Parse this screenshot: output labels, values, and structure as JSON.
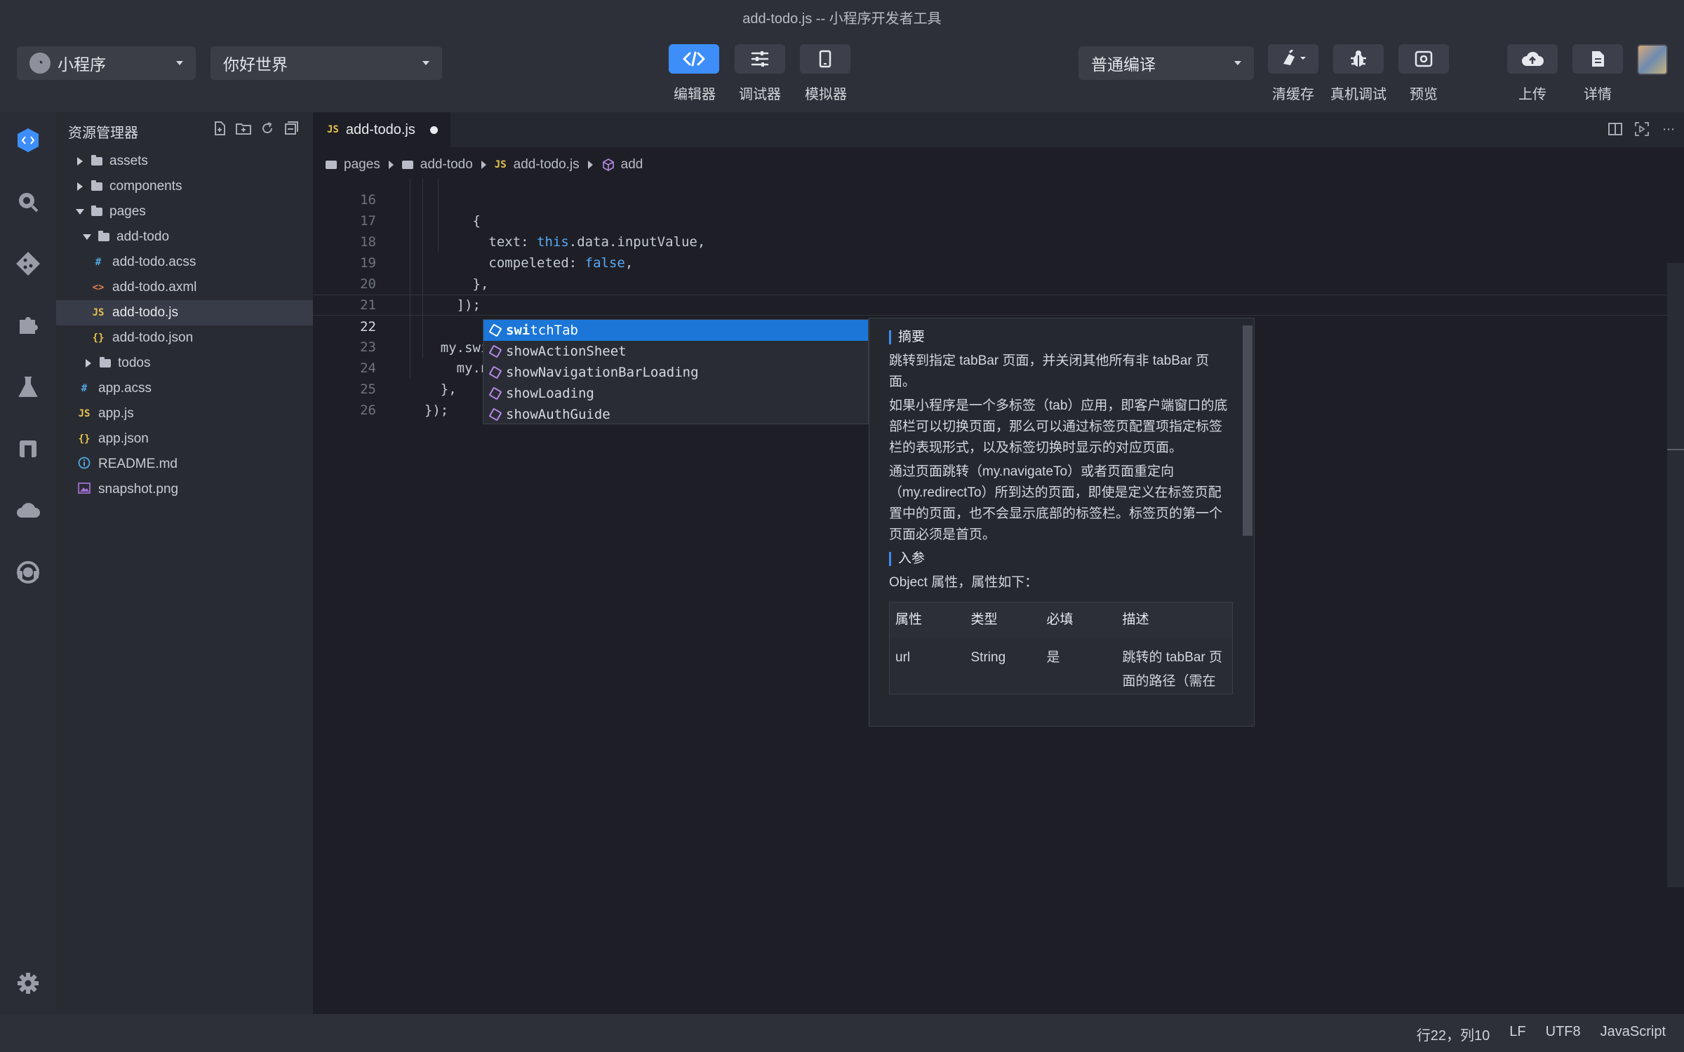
{
  "window": {
    "title": "add-todo.js -- 小程序开发者工具"
  },
  "toolbar": {
    "app_type": "小程序",
    "project": "你好世界",
    "compile_mode": "普通编译",
    "buttons": {
      "editor": "编辑器",
      "debugger": "调试器",
      "simulator": "模拟器",
      "clear_cache": "清缓存",
      "device_debug": "真机调试",
      "preview": "预览",
      "upload": "上传",
      "details": "详情"
    }
  },
  "activity_bar": {
    "items": [
      "code-icon",
      "search-icon",
      "git-icon",
      "extensions-icon",
      "test-flask-icon",
      "bookmark-icon",
      "cloud-icon",
      "support-headset-icon",
      "settings-gear-icon"
    ]
  },
  "explorer": {
    "title": "资源管理器",
    "tools": [
      "new-file-icon",
      "new-folder-icon",
      "refresh-icon",
      "collapse-icon"
    ],
    "tree": [
      {
        "label": "assets",
        "type": "folder",
        "expanded": false
      },
      {
        "label": "components",
        "type": "folder",
        "expanded": false
      },
      {
        "label": "pages",
        "type": "folder",
        "expanded": true
      },
      {
        "label": "add-todo",
        "type": "folder",
        "expanded": true
      },
      {
        "label": "add-todo.acss",
        "type": "acss",
        "icon": "#"
      },
      {
        "label": "add-todo.axml",
        "type": "axml",
        "icon": "<>"
      },
      {
        "label": "add-todo.js",
        "type": "js",
        "icon": "JS",
        "selected": true
      },
      {
        "label": "add-todo.json",
        "type": "json",
        "icon": "{}"
      },
      {
        "label": "todos",
        "type": "folder",
        "expanded": false
      },
      {
        "label": "app.acss",
        "type": "acss",
        "icon": "#"
      },
      {
        "label": "app.js",
        "type": "js",
        "icon": "JS"
      },
      {
        "label": "app.json",
        "type": "json",
        "icon": "{}"
      },
      {
        "label": "README.md",
        "type": "md",
        "icon": "i"
      },
      {
        "label": "snapshot.png",
        "type": "png",
        "icon": "img"
      }
    ]
  },
  "editor": {
    "tab": {
      "file_label": "add-todo.js",
      "type_label": "JS",
      "dirty": true
    },
    "breadcrumb": [
      "pages",
      "add-todo",
      "add-todo.js",
      "add"
    ],
    "breadcrumb_type_label": "JS",
    "lines": [
      {
        "num": "16",
        "text": "        {"
      },
      {
        "num": "17",
        "text": "          text: this.data.inputValue,"
      },
      {
        "num": "18",
        "text": "          compeleted: false,"
      },
      {
        "num": "19",
        "text": "        },"
      },
      {
        "num": "20",
        "text": "      ]);"
      },
      {
        "num": "21",
        "text": ""
      },
      {
        "num": "22",
        "text": "    my.swi"
      },
      {
        "num": "23",
        "text": "      my.na"
      },
      {
        "num": "24",
        "text": "    },"
      },
      {
        "num": "25",
        "text": "  });"
      },
      {
        "num": "26",
        "text": ""
      }
    ],
    "current_line": "22"
  },
  "suggestions": [
    {
      "label": "switchTab",
      "match": "swi",
      "rest": "tchTab",
      "selected": true
    },
    {
      "label": "showActionSheet",
      "selected": false
    },
    {
      "label": "showNavigationBarLoading",
      "selected": false
    },
    {
      "label": "showLoading",
      "selected": false
    },
    {
      "label": "showAuthGuide",
      "selected": false
    }
  ],
  "docs": {
    "summary_heading": "摘要",
    "p1": "跳转到指定 tabBar 页面，并关闭其他所有非 tabBar 页面。",
    "p2": "如果小程序是一个多标签（tab）应用，即客户端窗口的底部栏可以切换页面，那么可以通过标签页配置项指定标签栏的表现形式，以及标签切换时显示的对应页面。",
    "p3": "通过页面跳转（my.navigateTo）或者页面重定向（my.redirectTo）所到达的页面，即使是定义在标签页配置中的页面，也不会显示底部的标签栏。标签页的第一个页面必须是首页。",
    "params_heading": "入参",
    "params_intro": "Object 属性，属性如下：",
    "table": {
      "headers": [
        "属性",
        "类型",
        "必填",
        "描述"
      ],
      "row": [
        "url",
        "String",
        "是",
        "跳转的 tabBar 页面的路径（需在"
      ]
    }
  },
  "status_bar": {
    "position": "行22，列10",
    "eol": "LF",
    "encoding": "UTF8",
    "language": "JavaScript"
  }
}
